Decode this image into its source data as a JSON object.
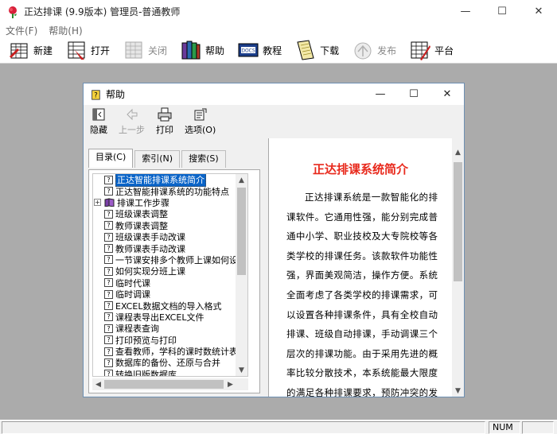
{
  "app": {
    "title": "正达排课 (9.9版本)  管理员-普通教师",
    "window_buttons": {
      "minimize": "—",
      "maximize": "☐",
      "close": "✕"
    }
  },
  "menu": [
    "文件(F)",
    "帮助(H)"
  ],
  "toolbar": [
    {
      "label": "新建",
      "icon": "new-schedule-icon",
      "enabled": true
    },
    {
      "label": "打开",
      "icon": "open-icon",
      "enabled": true
    },
    {
      "label": "关闭",
      "icon": "close-table-icon",
      "enabled": false
    },
    {
      "label": "帮助",
      "icon": "help-book-icon",
      "enabled": true
    },
    {
      "label": "教程",
      "icon": "docs-tutorial-icon",
      "enabled": true
    },
    {
      "label": "下载",
      "icon": "download-icon",
      "enabled": true
    },
    {
      "label": "发布",
      "icon": "publish-icon",
      "enabled": false
    },
    {
      "label": "平台",
      "icon": "platform-icon",
      "enabled": true
    }
  ],
  "status": {
    "num": "NUM"
  },
  "help_window": {
    "title": "帮助",
    "toolbar": [
      {
        "label": "隐藏",
        "icon": "hide-icon",
        "enabled": true
      },
      {
        "label": "上一步",
        "icon": "back-arrow-icon",
        "enabled": false
      },
      {
        "label": "打印",
        "icon": "print-icon",
        "enabled": true
      },
      {
        "label": "选项(O)",
        "icon": "options-icon",
        "enabled": true
      }
    ],
    "tabs": [
      "目录(C)",
      "索引(N)",
      "搜索(S)"
    ],
    "active_tab": "目录(C)",
    "tree": [
      {
        "label": "正达智能排课系统简介",
        "type": "topic",
        "selected": true
      },
      {
        "label": "正达智能排课系统的功能特点",
        "type": "topic"
      },
      {
        "label": "排课工作步骤",
        "type": "book",
        "expander": "+"
      },
      {
        "label": "班级课表调整",
        "type": "topic"
      },
      {
        "label": "教师课表调整",
        "type": "topic"
      },
      {
        "label": "班级课表手动改课",
        "type": "topic"
      },
      {
        "label": "教师课表手动改课",
        "type": "topic"
      },
      {
        "label": "一节课安排多个教师上课如何设",
        "type": "topic"
      },
      {
        "label": "如何实现分班上课",
        "type": "topic"
      },
      {
        "label": "临时代课",
        "type": "topic"
      },
      {
        "label": "临时调课",
        "type": "topic"
      },
      {
        "label": "EXCEL数据文档的导入格式",
        "type": "topic"
      },
      {
        "label": "课程表导出EXCEL文件",
        "type": "topic"
      },
      {
        "label": "课程表查询",
        "type": "topic"
      },
      {
        "label": "打印预览与打印",
        "type": "topic"
      },
      {
        "label": "查看教师，学科的课时数统计表",
        "type": "topic"
      },
      {
        "label": "数据库的备份、还原与合并",
        "type": "topic"
      },
      {
        "label": "转换旧版数据库",
        "type": "topic"
      }
    ],
    "content": {
      "title": "正达排课系统简介",
      "body": "正达排课系统是一款智能化的排课软件。它通用性强，能分别完成普通中小学、职业技校及大专院校等各类学校的排课任务。该款软件功能性强，界面美观简洁，操作方便。系统全面考虑了各类学校的排课需求，可以设置各种排课条件，具有全校自动排课、班级自动排课，手动调课三个层次的排课功能。由于采用先进的概率比较分散技术，本系统能最大限度的满足各种排课要求，预防冲突的发生。具有按天周排课、合班上课、单双周排课、多个教师上课、按"
    },
    "scroll_arrows": {
      "up": "▲",
      "down": "▼",
      "left": "◀",
      "right": "▶"
    }
  },
  "colors": {
    "selection": "#0a64c8",
    "content_title": "#e8291c",
    "workspace": "#ababab"
  }
}
